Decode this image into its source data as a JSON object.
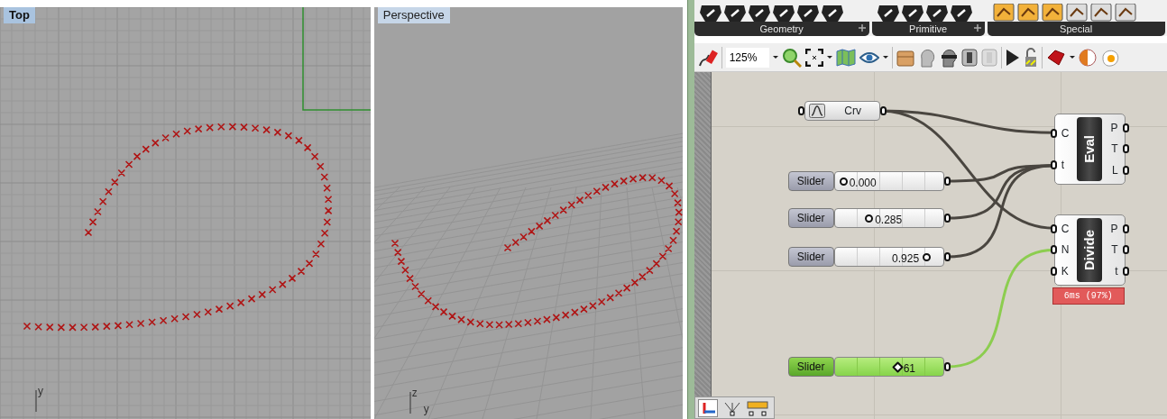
{
  "viewports": [
    {
      "title": "Top",
      "kind": "top",
      "axes": [
        "y"
      ]
    },
    {
      "title": "Perspective",
      "kind": "perspective",
      "axes": [
        "z",
        "y"
      ]
    }
  ],
  "ribbon": {
    "categories": [
      {
        "label": "Geometry"
      },
      {
        "label": "Primitive"
      },
      {
        "label": "Special"
      }
    ]
  },
  "toolbar": {
    "zoom": "125%"
  },
  "canvas": {
    "params": [
      {
        "label": "Crv"
      }
    ],
    "sliders": [
      {
        "label": "Slider",
        "value": "0.000",
        "level": 0.0,
        "selected": false
      },
      {
        "label": "Slider",
        "value": "0.285",
        "level": 0.285,
        "selected": false
      },
      {
        "label": "Slider",
        "value": "0.925",
        "level": 0.925,
        "selected": false
      },
      {
        "label": "Slider",
        "value": "61",
        "level": 0.6,
        "selected": true
      }
    ],
    "components": [
      {
        "name": "Eval",
        "inputs": [
          "C",
          "t"
        ],
        "outputs": [
          "P",
          "T",
          "L"
        ]
      },
      {
        "name": "Divide",
        "inputs": [
          "C",
          "N",
          "K"
        ],
        "outputs": [
          "P",
          "T",
          "t"
        ],
        "timing": "6ms (97%)"
      }
    ]
  }
}
